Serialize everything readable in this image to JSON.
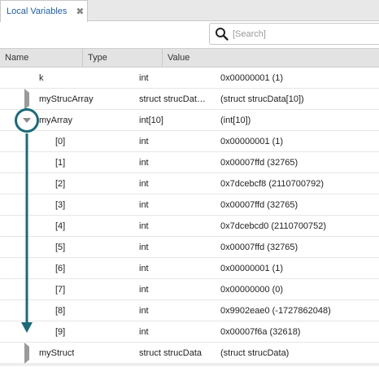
{
  "tab": {
    "label": "Local Variables",
    "close": "✖"
  },
  "search": {
    "placeholder": "[Search]"
  },
  "columns": {
    "name": "Name",
    "type": "Type",
    "value": "Value"
  },
  "rows": [
    {
      "name": "k",
      "type": "int",
      "value": "0x00000001 (1)",
      "expander": "none",
      "indent": 1
    },
    {
      "name": "myStrucArray",
      "type": "struct strucDat…",
      "value": "(struct strucData[10])",
      "expander": "collapsed",
      "indent": 1
    },
    {
      "name": "myArray",
      "type": "int[10]",
      "value": "(int[10])",
      "expander": "expanded",
      "indent": 1
    },
    {
      "name": "[0]",
      "type": "int",
      "value": "0x00000001 (1)",
      "expander": "none",
      "indent": 2
    },
    {
      "name": "[1]",
      "type": "int",
      "value": "0x00007ffd (32765)",
      "expander": "none",
      "indent": 2
    },
    {
      "name": "[2]",
      "type": "int",
      "value": "0x7dcebcf8 (2110700792)",
      "expander": "none",
      "indent": 2
    },
    {
      "name": "[3]",
      "type": "int",
      "value": "0x00007ffd (32765)",
      "expander": "none",
      "indent": 2
    },
    {
      "name": "[4]",
      "type": "int",
      "value": "0x7dcebcd0 (2110700752)",
      "expander": "none",
      "indent": 2
    },
    {
      "name": "[5]",
      "type": "int",
      "value": "0x00007ffd (32765)",
      "expander": "none",
      "indent": 2
    },
    {
      "name": "[6]",
      "type": "int",
      "value": "0x00000001 (1)",
      "expander": "none",
      "indent": 2
    },
    {
      "name": "[7]",
      "type": "int",
      "value": "0x00000000 (0)",
      "expander": "none",
      "indent": 2
    },
    {
      "name": "[8]",
      "type": "int",
      "value": "0x9902eae0 (-1727862048)",
      "expander": "none",
      "indent": 2
    },
    {
      "name": "[9]",
      "type": "int",
      "value": "0x00007f6a (32618)",
      "expander": "none",
      "indent": 2
    },
    {
      "name": "myStruct",
      "type": "struct strucData",
      "value": "(struct strucData)",
      "expander": "collapsed",
      "indent": 1
    }
  ],
  "colors": {
    "tab_text": "#1f5fa0",
    "annotation": "#1c6a78",
    "header_bg": "#e3e3e3"
  }
}
